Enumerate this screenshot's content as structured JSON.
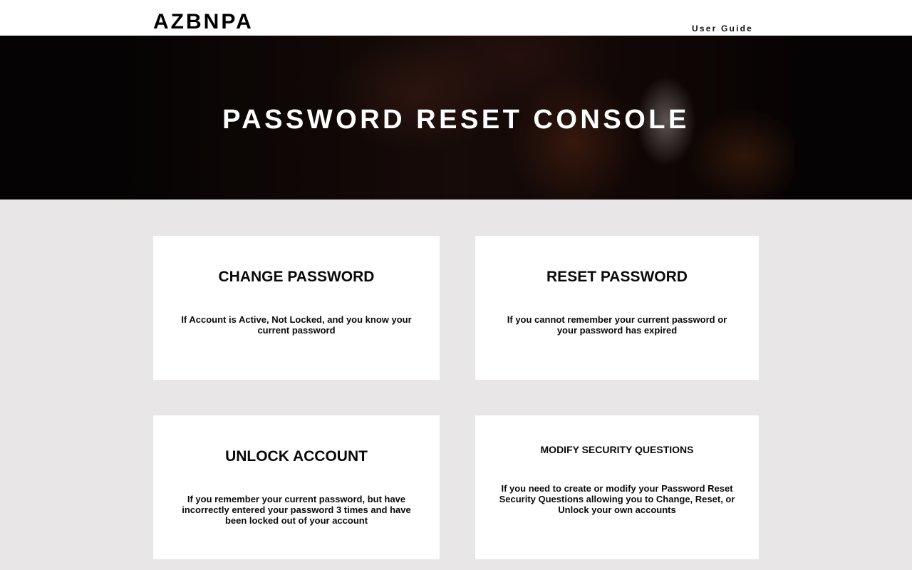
{
  "header": {
    "brand": "AZBNPA",
    "nav": {
      "user_guide": "User Guide"
    }
  },
  "hero": {
    "title": "PASSWORD RESET CONSOLE"
  },
  "cards": [
    {
      "title": "CHANGE PASSWORD",
      "description": "If Account is Active, Not Locked, and you know your current password"
    },
    {
      "title": "RESET PASSWORD",
      "description": "If you cannot remember your current password or your password has expired"
    },
    {
      "title": "UNLOCK ACCOUNT",
      "description": "If you remember your current password, but have incorrectly entered your password 3 times and have been locked out of your account"
    },
    {
      "title": "MODIFY SECURITY QUESTIONS",
      "description": "If you need to create or modify your Password Reset Security Questions allowing you to Change, Reset, or Unlock your own accounts"
    }
  ],
  "colors": {
    "page_background": "#e8e6e7",
    "card_background": "#ffffff",
    "hero_background": "#070404",
    "text_primary": "#0a0a0a",
    "hero_text": "#ffffff"
  }
}
